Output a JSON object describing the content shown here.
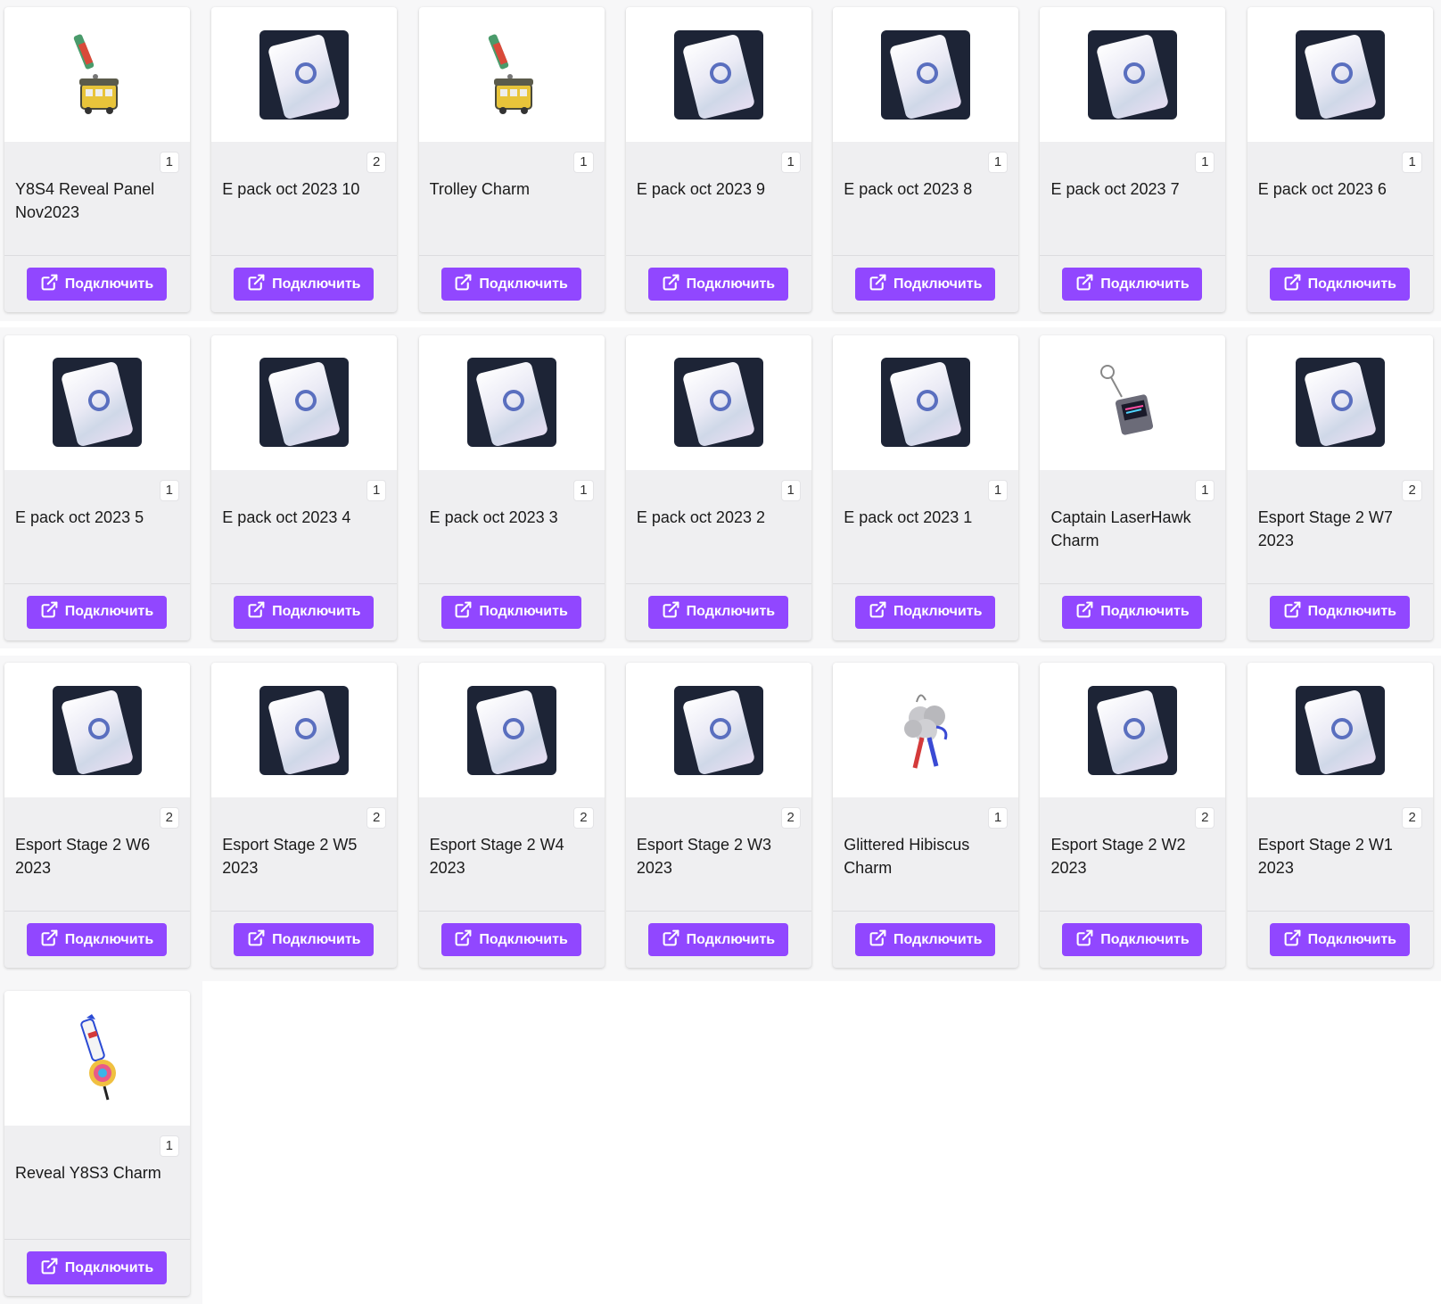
{
  "button_label": "Подключить",
  "accent_color": "#9147ff",
  "items": [
    {
      "name": "Y8S4 Reveal Panel Nov2023",
      "qty": "1",
      "icon": "tram-charm-icon"
    },
    {
      "name": "E pack oct 2023 10",
      "qty": "2",
      "icon": "esports-pack-icon"
    },
    {
      "name": "Trolley Charm",
      "qty": "1",
      "icon": "tram-charm-icon"
    },
    {
      "name": "E pack oct 2023 9",
      "qty": "1",
      "icon": "esports-pack-icon"
    },
    {
      "name": "E pack oct 2023 8",
      "qty": "1",
      "icon": "esports-pack-icon"
    },
    {
      "name": "E pack oct 2023 7",
      "qty": "1",
      "icon": "esports-pack-icon"
    },
    {
      "name": "E pack oct 2023 6",
      "qty": "1",
      "icon": "esports-pack-icon"
    },
    {
      "name": "E pack oct 2023 5",
      "qty": "1",
      "icon": "esports-pack-icon"
    },
    {
      "name": "E pack oct 2023 4",
      "qty": "1",
      "icon": "esports-pack-icon"
    },
    {
      "name": "E pack oct 2023 3",
      "qty": "1",
      "icon": "esports-pack-icon"
    },
    {
      "name": "E pack oct 2023 2",
      "qty": "1",
      "icon": "esports-pack-icon"
    },
    {
      "name": "E pack oct 2023 1",
      "qty": "1",
      "icon": "esports-pack-icon"
    },
    {
      "name": "Captain LaserHawk Charm",
      "qty": "1",
      "icon": "keychain-charm-icon"
    },
    {
      "name": "Esport Stage 2 W7 2023",
      "qty": "2",
      "icon": "esports-pack-icon"
    },
    {
      "name": "Esport Stage 2 W6 2023",
      "qty": "2",
      "icon": "esports-pack-icon"
    },
    {
      "name": "Esport Stage 2 W5 2023",
      "qty": "2",
      "icon": "esports-pack-icon"
    },
    {
      "name": "Esport Stage 2 W4 2023",
      "qty": "2",
      "icon": "esports-pack-icon"
    },
    {
      "name": "Esport Stage 2 W3 2023",
      "qty": "2",
      "icon": "esports-pack-icon"
    },
    {
      "name": "Glittered Hibiscus Charm",
      "qty": "1",
      "icon": "flower-charm-icon"
    },
    {
      "name": "Esport Stage 2 W2 2023",
      "qty": "2",
      "icon": "esports-pack-icon"
    },
    {
      "name": "Esport Stage 2 W1 2023",
      "qty": "2",
      "icon": "esports-pack-icon"
    },
    {
      "name": "Reveal Y8S3 Charm",
      "qty": "1",
      "icon": "rocket-charm-icon"
    }
  ]
}
